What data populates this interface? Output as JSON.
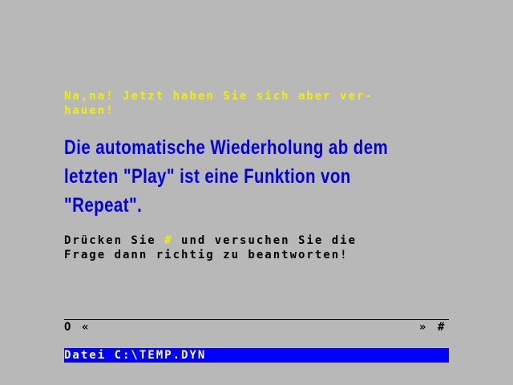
{
  "error_message": {
    "line1": "Na,na! Jetzt haben Sie sich aber ver-",
    "line2": "hauen!"
  },
  "explanation": {
    "line1": "Die automatische Wiederholung ab dem",
    "line2": "letzten \"Play\" ist eine Funktion von",
    "line3": "\"Repeat\"."
  },
  "instruction": {
    "line1_part1": "Drücken Sie ",
    "hash_key": "#",
    "line1_part2": " und versuchen Sie die",
    "line2": "Frage dann richtig zu beantworten!"
  },
  "navigation": {
    "first_button": "O",
    "prev_button": "«",
    "next_button": "»",
    "hash_button": "#"
  },
  "status_bar": {
    "file_label": "Datei C:\\TEMP.DYN"
  },
  "colors": {
    "background": "#B8B8B8",
    "yellow": "#F0F000",
    "blue_text": "#0000E8",
    "status_bar": "#0000F8"
  }
}
